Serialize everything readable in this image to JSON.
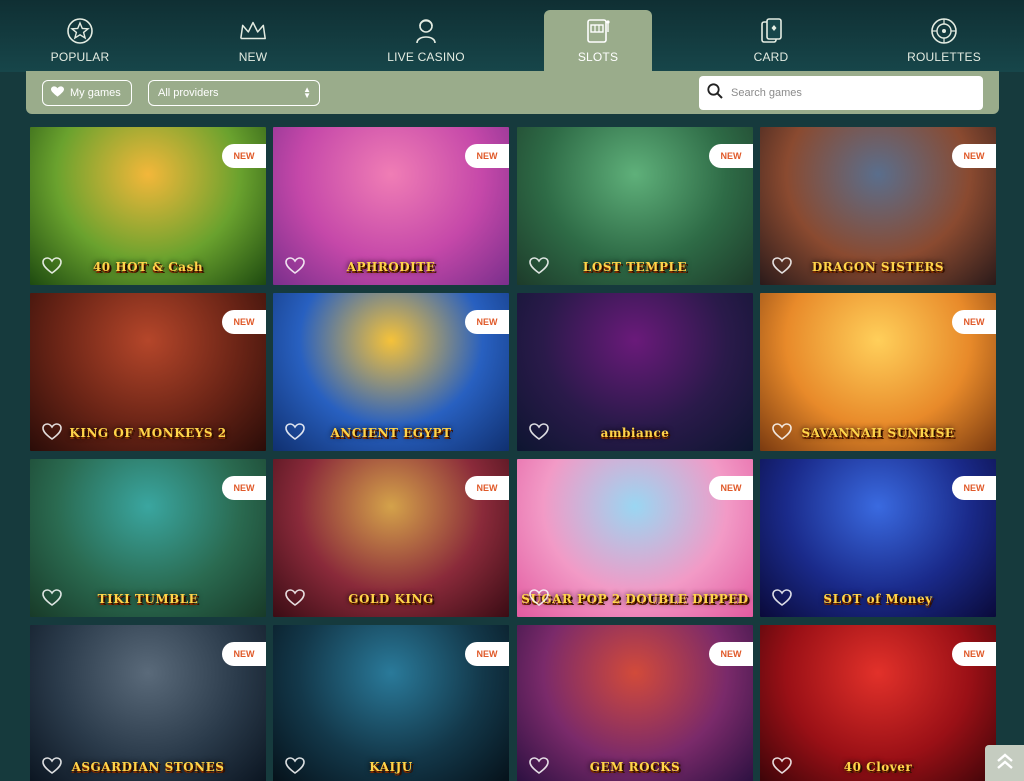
{
  "nav": {
    "tabs": [
      {
        "label": "POPULAR",
        "icon": "star-icon"
      },
      {
        "label": "NEW",
        "icon": "crown-icon"
      },
      {
        "label": "LIVE CASINO",
        "icon": "dealer-icon"
      },
      {
        "label": "SLOTS",
        "icon": "slot-machine-icon",
        "active": true
      },
      {
        "label": "CARD",
        "icon": "cards-icon"
      },
      {
        "label": "ROULETTES",
        "icon": "roulette-icon"
      }
    ]
  },
  "filters": {
    "my_games_label": "My games",
    "providers_label": "All providers",
    "search_placeholder": "Search games"
  },
  "badge_text": "NEW",
  "games": [
    {
      "title": "40 HOT & Cash",
      "new": true,
      "bg": [
        "#f3b73a",
        "#6aa22e",
        "#1e4a10"
      ]
    },
    {
      "title": "APHRODITE",
      "new": true,
      "bg": [
        "#f07db5",
        "#c548a9",
        "#7a2f8c"
      ]
    },
    {
      "title": "LOST TEMPLE",
      "new": true,
      "bg": [
        "#5fb07a",
        "#2e6b46",
        "#1d3b2a"
      ]
    },
    {
      "title": "DRAGON SISTERS",
      "new": true,
      "bg": [
        "#5a6e8c",
        "#8a4a30",
        "#2a1a1a"
      ]
    },
    {
      "title": "KING OF MONKEYS 2",
      "new": true,
      "bg": [
        "#b5462a",
        "#6a2416",
        "#2a0c08"
      ]
    },
    {
      "title": "ANCIENT EGYPT",
      "new": true,
      "bg": [
        "#f5c23a",
        "#2860c0",
        "#103070"
      ]
    },
    {
      "title": "ambiance",
      "new": false,
      "bg": [
        "#6a1a7a",
        "#2a1a4a",
        "#0d1530"
      ]
    },
    {
      "title": "SAVANNAH SUNRISE",
      "new": true,
      "bg": [
        "#ffcf5a",
        "#e88a2a",
        "#7a3a10"
      ]
    },
    {
      "title": "TIKI TUMBLE",
      "new": true,
      "bg": [
        "#3aa6a0",
        "#2a6a50",
        "#183a28"
      ]
    },
    {
      "title": "GOLD KING",
      "new": true,
      "bg": [
        "#d4a24a",
        "#8a2a3a",
        "#3a0c14"
      ]
    },
    {
      "title": "SUGAR POP 2 DOUBLE DIPPED",
      "new": true,
      "bg": [
        "#9ad6f2",
        "#f29ac6",
        "#e25aa0"
      ]
    },
    {
      "title": "SLOT of Money",
      "new": true,
      "bg": [
        "#3a6ae0",
        "#1a2a8a",
        "#0a0a3a"
      ]
    },
    {
      "title": "ASGARDIAN STONES",
      "new": true,
      "bg": [
        "#5a6a7a",
        "#2a3a4a",
        "#0a1420"
      ]
    },
    {
      "title": "KAIJU",
      "new": true,
      "bg": [
        "#2a7a9a",
        "#13384a",
        "#051018"
      ]
    },
    {
      "title": "GEM ROCKS",
      "new": true,
      "bg": [
        "#d24a3a",
        "#7a2a6a",
        "#2a1040"
      ]
    },
    {
      "title": "40 Clover",
      "new": true,
      "bg": [
        "#e2312a",
        "#9a1016",
        "#3a0408"
      ]
    }
  ],
  "colors": {
    "page_bg": "#163a3d",
    "accent": "#9aac8b",
    "badge_text": "#e05a2a"
  }
}
